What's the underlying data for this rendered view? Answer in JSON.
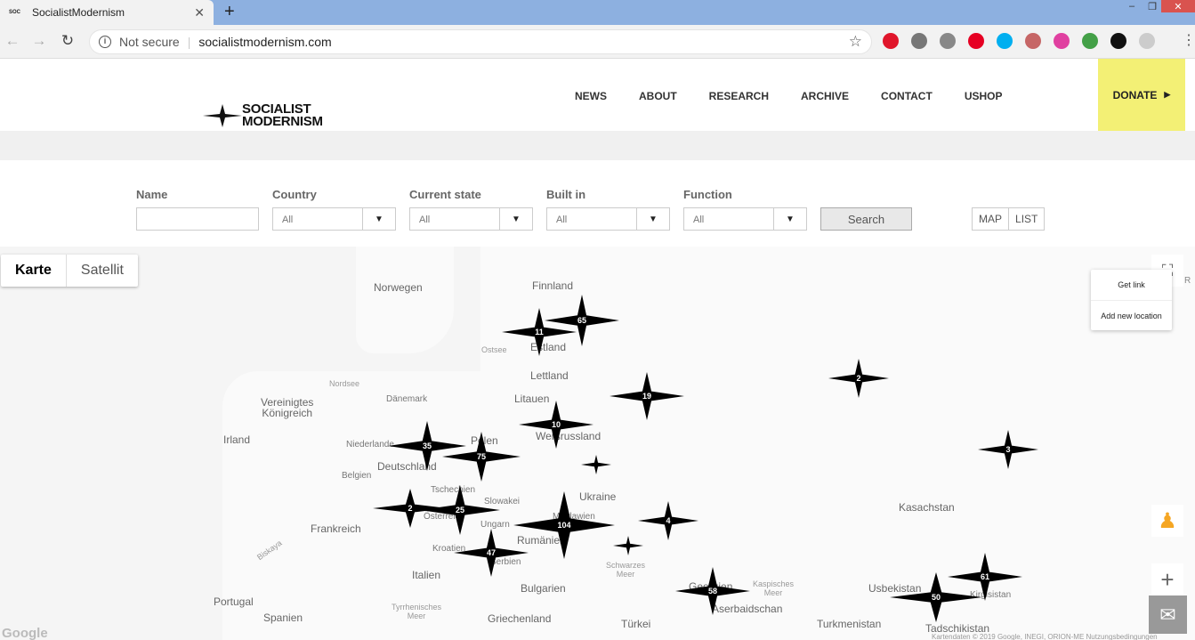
{
  "browser": {
    "tab_title": "SocialistModernism",
    "favicon_text": "SOC",
    "url_security": "Not secure",
    "url": "socialistmodernism.com",
    "extensions": [
      {
        "name": "opera-icon",
        "color": "#e0162b"
      },
      {
        "name": "record-icon",
        "color": "#777777"
      },
      {
        "name": "drive-icon",
        "color": "#888888"
      },
      {
        "name": "pinterest-icon",
        "color": "#e60023"
      },
      {
        "name": "skype-icon",
        "color": "#00aff0"
      },
      {
        "name": "pdf-icon",
        "color": "#c66666"
      },
      {
        "name": "colorwheel-icon",
        "color": "#e040a0"
      },
      {
        "name": "mail-ext-icon",
        "color": "#43a047"
      },
      {
        "name": "sh-icon",
        "color": "#111111"
      },
      {
        "name": "profile-icon",
        "color": "#cccccc"
      }
    ]
  },
  "site": {
    "logo_line1": "SOCIALIST",
    "logo_line2": "MODERNISM",
    "nav": [
      "NEWS",
      "ABOUT",
      "RESEARCH",
      "ARCHIVE",
      "CONTACT",
      "USHOP"
    ],
    "donate_label": "DONATE",
    "donate_color": "#f3f075"
  },
  "filter": {
    "name_label": "Name",
    "country_label": "Country",
    "country_value": "All",
    "state_label": "Current state",
    "state_value": "All",
    "built_label": "Built in",
    "built_value": "All",
    "function_label": "Function",
    "function_value": "All",
    "search_label": "Search",
    "view_map": "MAP",
    "view_list": "LIST"
  },
  "map": {
    "type_karte": "Karte",
    "type_satellit": "Satellit",
    "get_link": "Get link",
    "add_location": "Add new location",
    "edge_letter": "R",
    "google": "Google",
    "attribution": "Kartendaten © 2019 Google, INEGI, ORION-ME    Nutzungsbedingungen",
    "labels": {
      "norwegen": "Norwegen",
      "finnland": "Finnland",
      "estland": "Estland",
      "ostsee": "Ostsee",
      "lettland": "Lettland",
      "nordsee": "Nordsee",
      "daenemark": "Dänemark",
      "litauen": "Litauen",
      "vk1": "Vereinigtes",
      "vk2": "Königreich",
      "irland": "Irland",
      "niederlande": "Niederlande",
      "polen": "Polen",
      "weissrussland": "Weißrussland",
      "deutschland": "Deutschland",
      "belgien": "Belgien",
      "tschechien": "Tschechien",
      "slowakei": "Slowakei",
      "ukraine": "Ukraine",
      "oesterreich": "Österreich",
      "ungarn": "Ungarn",
      "moldawien": "Moldawien",
      "frankreich": "Frankreich",
      "rumaenien": "Rumänien",
      "kroatien": "Kroatien",
      "serbien": "Serbien",
      "biskaya": "Biskaya",
      "italien": "Italien",
      "schwarzes1": "Schwarzes",
      "schwarzes2": "Meer",
      "bulgarien": "Bulgarien",
      "georgien": "Georgien",
      "kaspisches1": "Kaspisches",
      "kaspisches2": "Meer",
      "aserbaidschan": "Aserbaidschan",
      "portugal": "Portugal",
      "tyrrh1": "Tyrrhenisches",
      "tyrrh2": "Meer",
      "spanien": "Spanien",
      "griechenland": "Griechenland",
      "tuerkei": "Türkei",
      "turkmenistan": "Turkmenistan",
      "usbekistan": "Usbekistan",
      "kirgisistan": "Kirgisistan",
      "tadschikistan": "Tadschikistan",
      "kasachstan": "Kasachstan"
    },
    "clusters": [
      "11",
      "65",
      "2",
      "19",
      "10",
      "3",
      "35",
      "75",
      "2",
      "25",
      "104",
      "4",
      "47",
      "58",
      "50",
      "61"
    ]
  }
}
